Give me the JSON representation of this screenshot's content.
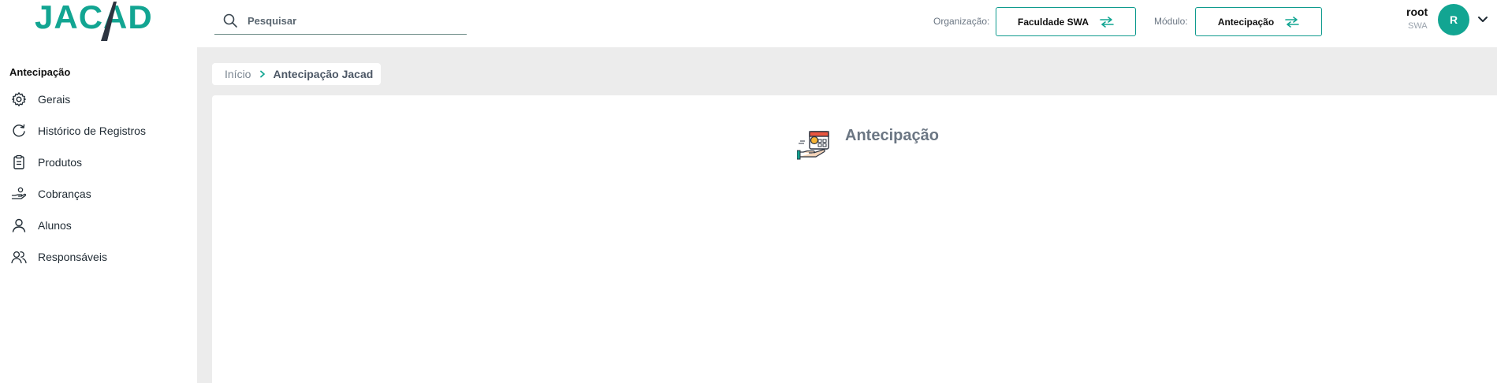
{
  "brand": {
    "logo_text": "JACAD"
  },
  "search": {
    "placeholder": "Pesquisar",
    "value": ""
  },
  "header": {
    "organization_label": "Organização:",
    "organization_value": "Faculdade SWA",
    "module_label": "Módulo:",
    "module_value": "Antecipação"
  },
  "user": {
    "name": "root",
    "org": "SWA",
    "avatar_initial": "R"
  },
  "sidebar": {
    "title": "Antecipação",
    "items": [
      {
        "label": "Gerais",
        "icon": "gear-icon"
      },
      {
        "label": "Histórico de Registros",
        "icon": "refresh-icon"
      },
      {
        "label": "Produtos",
        "icon": "clipboard-icon"
      },
      {
        "label": "Cobranças",
        "icon": "hand-coin-icon"
      },
      {
        "label": "Alunos",
        "icon": "user-icon"
      },
      {
        "label": "Responsáveis",
        "icon": "users-icon"
      }
    ]
  },
  "breadcrumb": {
    "home": "Início",
    "current": "Antecipação Jacad"
  },
  "main": {
    "title": "Antecipação",
    "icon": "calendar-hand-icon"
  },
  "colors": {
    "accent": "#12a592",
    "logo_dark": "#2d3440",
    "content_bg": "#ececec"
  }
}
